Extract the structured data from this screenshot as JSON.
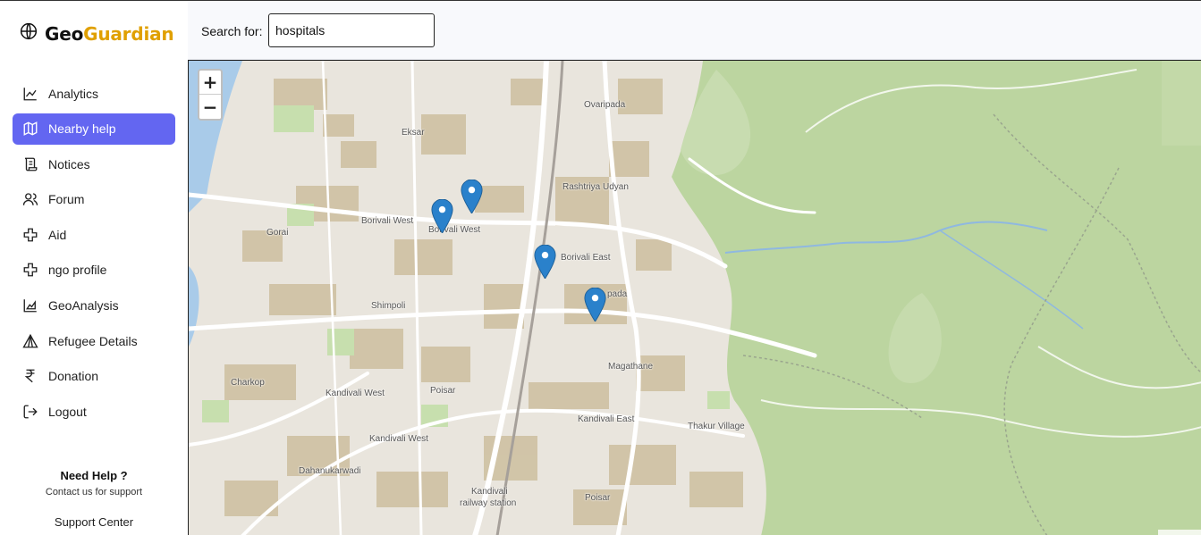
{
  "brand": {
    "name_part1": "Geo",
    "name_part2": "Guardian",
    "accent": "#e0a000"
  },
  "search": {
    "label": "Search for:",
    "value": "hospitals"
  },
  "sidebar": {
    "items": [
      {
        "label": "Analytics",
        "icon": "chart-line-icon"
      },
      {
        "label": "Nearby help",
        "icon": "map-icon",
        "active": true
      },
      {
        "label": "Notices",
        "icon": "scroll-icon"
      },
      {
        "label": "Forum",
        "icon": "users-icon"
      },
      {
        "label": "Aid",
        "icon": "plus-outline-icon"
      },
      {
        "label": "ngo profile",
        "icon": "plus-outline-icon"
      },
      {
        "label": "GeoAnalysis",
        "icon": "area-chart-icon"
      },
      {
        "label": "Refugee Details",
        "icon": "tent-icon"
      },
      {
        "label": "Donation",
        "icon": "rupee-icon"
      },
      {
        "label": "Logout",
        "icon": "logout-icon"
      }
    ],
    "active_color": "#6366f1"
  },
  "help": {
    "title": "Need Help ?",
    "subtitle": "Contact us for support",
    "link": "Support Center"
  },
  "map": {
    "zoom_in": "+",
    "zoom_out": "−",
    "places": [
      "Ovaripada",
      "Eksar",
      "Rashtriya Udyan",
      "Borivali West",
      "Borivali West",
      "Gorai",
      "Borivali East",
      "Magathane",
      "Shimpoli",
      "Charkop",
      "Kandivali West",
      "Poisar",
      "Kandivali East",
      "Thakur Village",
      "Kandivali West",
      "Dahanukarwadi",
      "Kandivali",
      "railway station",
      "Poisar",
      "pada"
    ],
    "marker_count": 4,
    "marker_color": "#2a81cb"
  }
}
